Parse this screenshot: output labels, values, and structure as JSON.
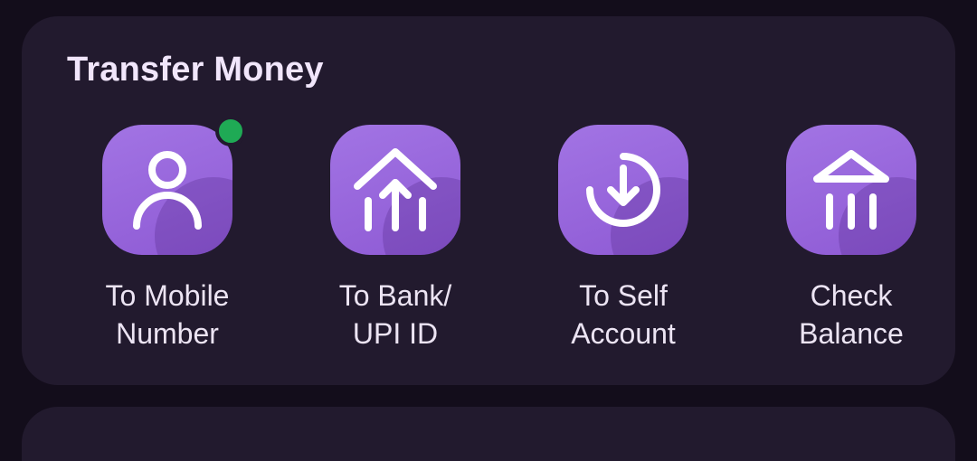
{
  "transfer_money": {
    "title": "Transfer Money",
    "actions": [
      {
        "line1": "To Mobile",
        "line2": "Number",
        "icon": "person-icon",
        "has_new_dot": true
      },
      {
        "line1": "To Bank/",
        "line2": "UPI ID",
        "icon": "bank-transfer-icon",
        "has_new_dot": false
      },
      {
        "line1": "To Self",
        "line2": "Account",
        "icon": "self-transfer-icon",
        "has_new_dot": false
      },
      {
        "line1": "Check",
        "line2": "Balance",
        "icon": "bank-balance-icon",
        "has_new_dot": false
      }
    ]
  },
  "colors": {
    "background": "#130d1b",
    "card": "#221a2e",
    "icon_tile": "#9c6be0",
    "text": "#ece4f3",
    "new_dot": "#1faa55"
  }
}
